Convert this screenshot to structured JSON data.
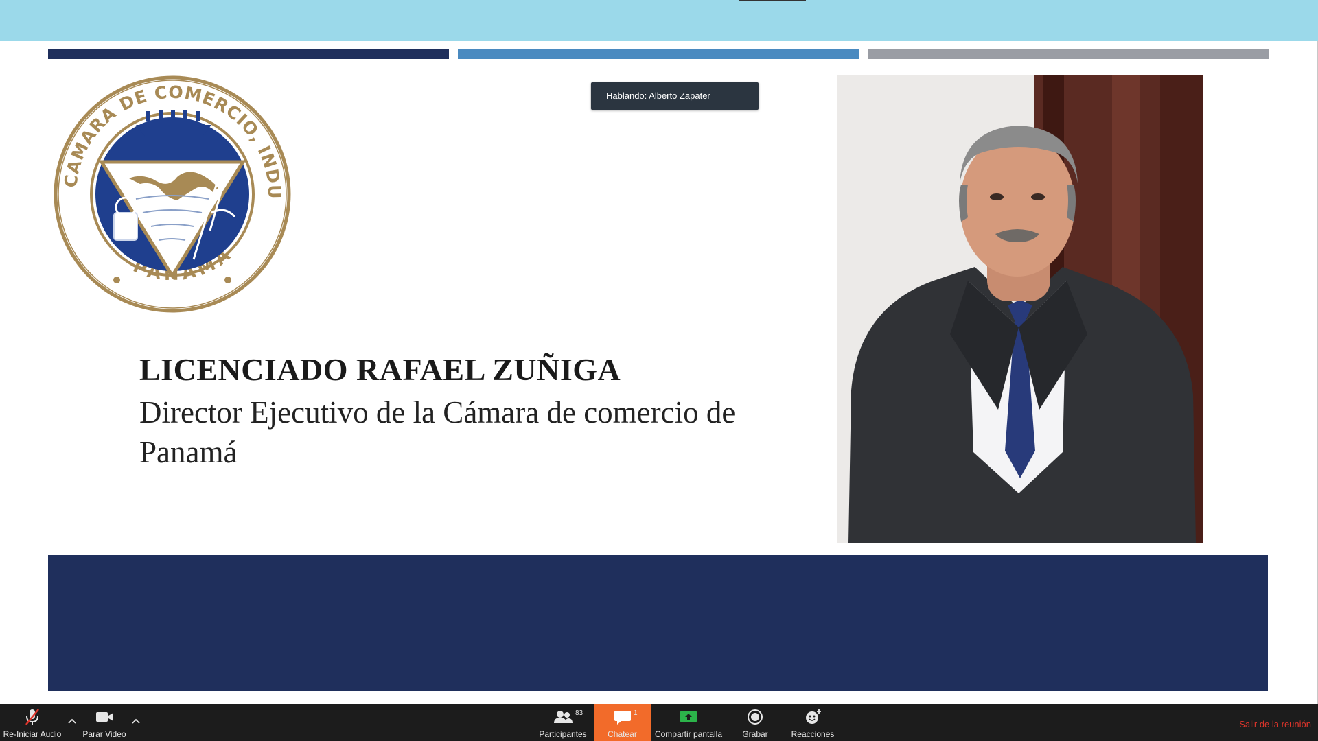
{
  "meeting": {
    "speaking_label": "Hablando: Alberto Zapater"
  },
  "slide": {
    "title": "LICENCIADO RAFAEL ZUÑIGA",
    "subtitle": "Director Ejecutivo de la Cámara de comercio de Panamá",
    "logo": {
      "ring_text": "CAMARA DE COMERCIO, INDUSTRIAS Y AGRICULTURA",
      "bottom_text": "PANAMÁ"
    },
    "colors": {
      "navy": "#1f2f5c",
      "blue": "#4a8ac0",
      "gray": "#9a9da4",
      "gold": "#a88a55",
      "top_bar": "#9bd9ea"
    }
  },
  "toolbar": {
    "audio_label": "Re-Iniciar Audio",
    "video_label": "Parar Video",
    "participants_label": "Participantes",
    "participants_count": "83",
    "chat_label": "Chatear",
    "chat_badge": "1",
    "share_label": "Compartir pantalla",
    "record_label": "Grabar",
    "reactions_label": "Reacciones",
    "leave_label": "Salir de la reunión",
    "colors": {
      "active": "#f26b2a",
      "leave": "#e0352b",
      "share": "#2cb34a"
    }
  }
}
